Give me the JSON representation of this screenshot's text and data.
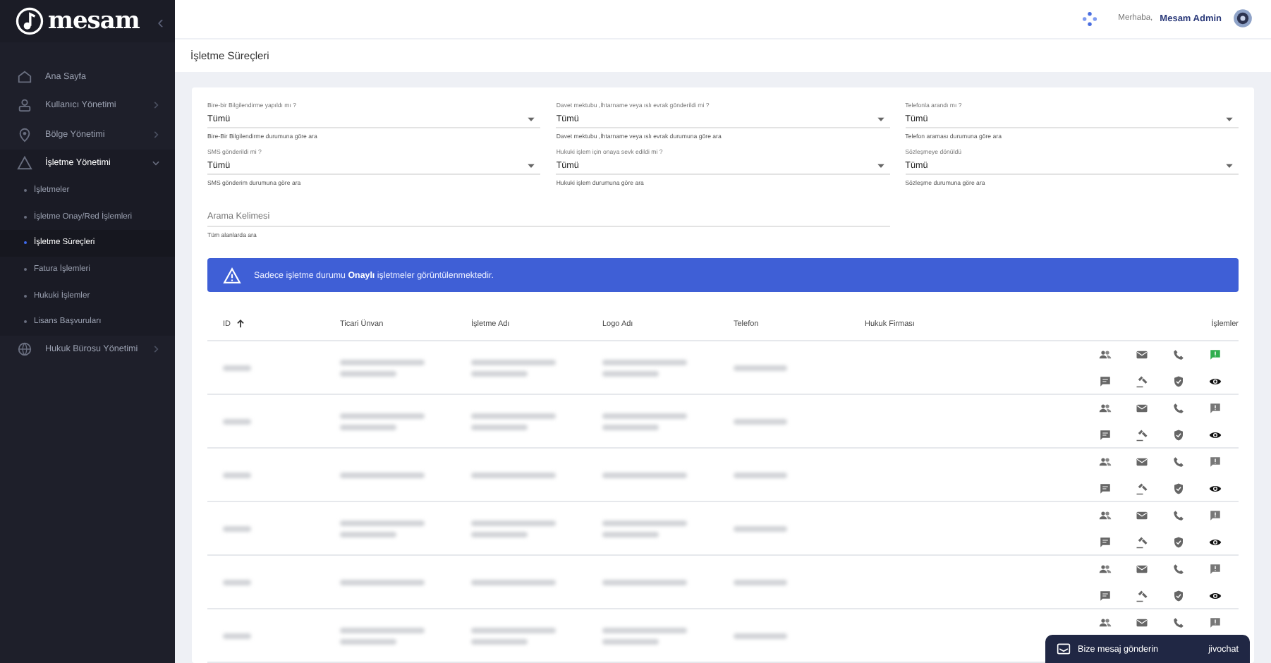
{
  "sidebar": {
    "logo": "mesam",
    "collapse_icon": "‹",
    "items": [
      {
        "label": "Ana Sayfa",
        "selected": false
      },
      {
        "label": "Kullanıcı Yönetimi",
        "expanded": false,
        "selected": false
      },
      {
        "label": "Bölge Yönetimi",
        "expanded": false,
        "selected": false
      },
      {
        "label": "İşletme Yönetimi",
        "expanded": true,
        "selected": false,
        "children": [
          {
            "label": "İşletmeler",
            "selected": false
          },
          {
            "label": "İşletme Onay/Red İşlemleri",
            "selected": false
          },
          {
            "label": "İşletme Süreçleri",
            "selected": true
          },
          {
            "label": "Fatura İşlemleri",
            "selected": false
          },
          {
            "label": "Hukuki İşlemler",
            "selected": false
          },
          {
            "label": "Lisans Başvuruları",
            "selected": false
          }
        ]
      },
      {
        "label": "Hukuk Bürosu Yönetimi",
        "expanded": false,
        "selected": false
      }
    ]
  },
  "header": {
    "greeting": "Merhaba,",
    "user": "Mesam Admin"
  },
  "page_title": "İşletme Süreçleri",
  "filters": [
    {
      "label": "Bire-bir Bilgilendirme yapıldı mı ?",
      "value": "Tümü",
      "hint": "Bire-Bir Bilgilendirme durumuna göre ara"
    },
    {
      "label": "Davet mektubu ,İhtarname veya ıslı evrak gönderildi mi ?",
      "value": "Tümü",
      "hint": "Davet mektubu ,İhtarname veya ıslı evrak durumuna göre ara"
    },
    {
      "label": "Telefonla arandı mı ?",
      "value": "Tümü",
      "hint": "Telefon araması durumuna göre ara"
    },
    {
      "label": "SMS gönderildi mi ?",
      "value": "Tümü",
      "hint": "SMS gönderim durumuna göre ara"
    },
    {
      "label": "Hukuki işlem için onaya sevk edildi mi ?",
      "value": "Tümü",
      "hint": "Hukuki işlem durumuna göre ara"
    },
    {
      "label": "Sözleşmeye dönüldü",
      "value": "Tümü",
      "hint": "Sözleşme durumuna göre ara"
    }
  ],
  "search": {
    "placeholder": "Arama Kelimesi",
    "hint": "Tüm alanlarda ara"
  },
  "alert": {
    "text": "Sadece işletme durumu **Onaylı** işletmeler görüntülenmektedir."
  },
  "table": {
    "columns": [
      {
        "label": "ID"
      },
      {
        "label": "Ticari Ünvan"
      },
      {
        "label": "İşletme Adı"
      },
      {
        "label": "Logo Adı"
      },
      {
        "label": "Telefon"
      },
      {
        "label": "Hukuk Firması"
      },
      {
        "label": "İşlemler"
      }
    ],
    "rows": [
      {
        "kind": "redacted",
        "multiline": true,
        "feedback_flagged": true
      },
      {
        "kind": "redacted",
        "multiline": true,
        "feedback_flagged": false
      },
      {
        "kind": "redacted",
        "multiline": false,
        "feedback_flagged": false
      },
      {
        "kind": "redacted",
        "multiline": true,
        "feedback_flagged": false
      },
      {
        "kind": "redacted",
        "multiline": false,
        "feedback_flagged": false
      },
      {
        "kind": "redacted",
        "multiline": true,
        "feedback_flagged": false
      }
    ]
  },
  "chat": {
    "label": "Bize mesaj gönderin",
    "brand": "jivochat"
  }
}
